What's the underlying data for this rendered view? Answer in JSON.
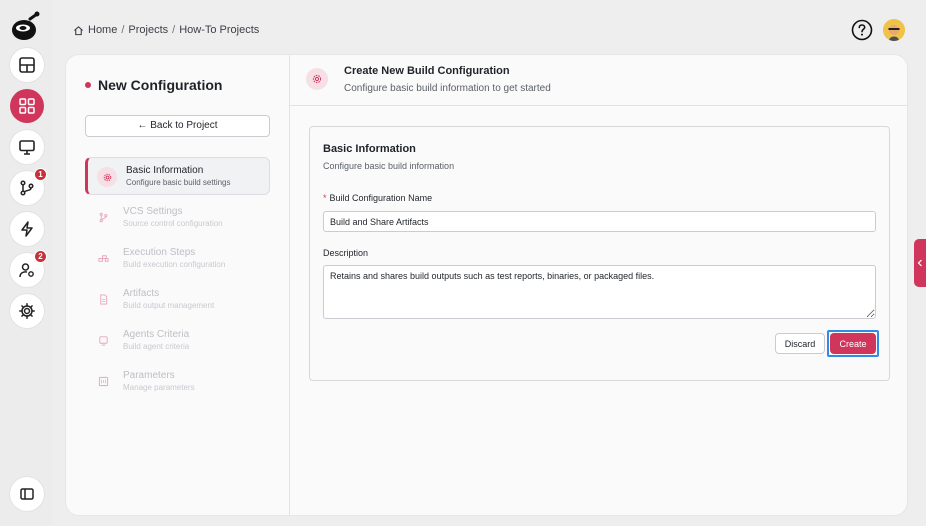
{
  "breadcrumb": {
    "home": "Home",
    "projects": "Projects",
    "current": "How-To Projects",
    "separator": "/"
  },
  "rail": {
    "badges": {
      "merge": "1",
      "users": "2"
    },
    "active_item": "grid"
  },
  "left_panel": {
    "title": "New Configuration",
    "back_label": "← Back to Project",
    "steps": [
      {
        "title": "Basic Information",
        "subtitle": "Configure basic build settings",
        "icon": "gear-icon",
        "active": true
      },
      {
        "title": "VCS Settings",
        "subtitle": "Source control configuration",
        "icon": "branch-icon",
        "active": false
      },
      {
        "title": "Execution Steps",
        "subtitle": "Build execution configuration",
        "icon": "steps-icon",
        "active": false
      },
      {
        "title": "Artifacts",
        "subtitle": "Build output management",
        "icon": "file-icon",
        "active": false
      },
      {
        "title": "Agents Criteria",
        "subtitle": "Build agent criteria",
        "icon": "agent-icon",
        "active": false
      },
      {
        "title": "Parameters",
        "subtitle": "Manage parameters",
        "icon": "parameters-icon",
        "active": false
      }
    ]
  },
  "header": {
    "title": "Create New Build Configuration",
    "subtitle": "Configure basic build information to get started"
  },
  "form": {
    "section_title": "Basic Information",
    "section_subtitle": "Configure basic build information",
    "name_label": "Build Configuration Name",
    "required_mark": "*",
    "name_value": "Build and Share Artifacts",
    "description_label": "Description",
    "description_value": "Retains and shares build outputs such as test reports, binaries, or packaged files.",
    "discard_label": "Discard",
    "create_label": "Create"
  },
  "colors": {
    "accent": "#d0355c",
    "focus_ring": "#2f8be6",
    "background": "#eeeeef"
  }
}
